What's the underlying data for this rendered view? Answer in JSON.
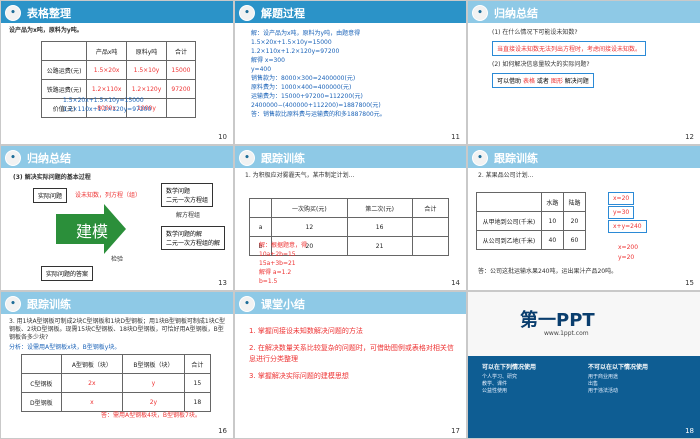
{
  "slides": [
    {
      "number": "10",
      "title": "表格整理",
      "subtitle": "设产品为x吨，原料为y吨。",
      "table": {
        "headers": [
          "",
          "产品x吨",
          "原料y吨",
          "合计"
        ],
        "rows": [
          [
            "公路运费(元)",
            "1.5×20x",
            "1.5×10y",
            "15000"
          ],
          [
            "铁路运费(元)",
            "1.2×110x",
            "1.2×120y",
            "97200"
          ],
          [
            "价值(元)",
            "8000x",
            "1000y",
            ""
          ]
        ]
      },
      "equations": [
        "1.5×20x+1.5×10y=15000",
        "1.2×110x+1.2×120y=97200"
      ]
    },
    {
      "number": "11",
      "title": "解题过程",
      "lines": [
        "解：设产品为x吨，原料为y吨，由题意得",
        "1.5×20x+1.5×10y=15000",
        "1.2×110x+1.2×120y=97200",
        "解得 x=300",
        "y=400",
        "销售款为：8000×300=2400000(元)",
        "原料费为：1000×400=400000(元)",
        "运输费为：15000+97200=112200(元)",
        "2400000−(400000+112200)=1887800(元)",
        "答：销售款比原料费与运输费的和多1887800元。"
      ]
    },
    {
      "number": "12",
      "title": "归纳总结",
      "q1": "(1) 在什么情况下可能设未知数?",
      "a1": "当直接设未知数无法列出方程时，考虑间接设未知数。",
      "q2": "(2) 如何解决信息量较大的实际问题?",
      "a2_prefix": "可以借助",
      "a2_highlight_1": "表格",
      "a2_mid": "或者",
      "a2_highlight_2": "图形",
      "a2_suffix": "解决问题"
    },
    {
      "number": "13",
      "title": "归纳总结",
      "subtitle": "(3) 解决实际问题的基本过程",
      "left_top": "实际问题",
      "arrow_label": "设未知数，列方程（组）",
      "right_top_1": "数学问题",
      "right_top_2": "二元一次方程组",
      "center": "建模",
      "right_mid_1": "数学问题的解",
      "right_mid_2": "二元一次方程组的解",
      "bottom": "实际问题的答案",
      "test": "检验",
      "solve": "解方程组"
    },
    {
      "number": "14",
      "title": "跟踪训练",
      "text": "1. 为积极应对雾霾天气，某市制定计划...",
      "table": {
        "headers": [
          "",
          "一次购买(元)",
          "第二次(元)",
          "合计"
        ],
        "rows": [
          [
            "a",
            "12",
            "16",
            ""
          ],
          [
            "b",
            "20",
            "21",
            ""
          ]
        ]
      },
      "answers": [
        "解：根据题意，得",
        "10a+2b=15",
        "15a+3b=21",
        "解得 a=1.2",
        "b=1.5"
      ]
    },
    {
      "number": "15",
      "title": "跟踪训练",
      "text": "2. 某果品公司计划...",
      "table": {
        "headers": [
          "",
          "水路",
          "陆路"
        ],
        "rows": [
          [
            "从甲地到公司(千米)",
            "10",
            "20"
          ],
          [
            "从公司到乙地(千米)",
            "40",
            "60"
          ]
        ]
      },
      "boxes": [
        "x=20",
        "y=30",
        "x+y=240"
      ],
      "answer": "答：公司这批运输水果240吨，运出果汁产品20吨。",
      "answer_vals": [
        "x=200",
        "y=20"
      ]
    },
    {
      "number": "16",
      "title": "跟踪训练",
      "text": "3. 用1块A型钢板可制成2块C型钢板和1块D型钢板；用1块B型钢板可制成1块C型钢板、2块D型钢板。现需15块C型钢板、18块D型钢板，可恰好用A型钢板，B型钢板各多少块?",
      "setup": "分析：设需用A型钢板x块，B型钢板y块。",
      "table": {
        "headers": [
          "",
          "A型钢板（块）",
          "B型钢板（块）",
          "合计"
        ],
        "rows": [
          [
            "C型钢板",
            "2x",
            "y",
            "15"
          ],
          [
            "D型钢板",
            "x",
            "2y",
            "18"
          ]
        ]
      },
      "answer": "答：需用A型钢板4块，B型钢板7块。"
    },
    {
      "number": "17",
      "title": "课堂小结",
      "items": [
        "1. 掌握间接设未知数解决问题的方法",
        "2. 在解决数量关系比较复杂的问题时，可借助图例或表格对相关信息进行分类整理",
        "3. 掌握解决实际问题的建模思想"
      ]
    },
    {
      "number": "18",
      "brand": "第一PPT",
      "url": "www.1ppt.com",
      "left_col_title": "可以在下列情况使用",
      "right_col_title": "不可以在以下情况使用",
      "left_lines": [
        "个人学习、研究",
        "教学、课件",
        "公益性使用"
      ],
      "right_lines": [
        "用于商业用途",
        "出售",
        "用于违法活动"
      ]
    }
  ]
}
